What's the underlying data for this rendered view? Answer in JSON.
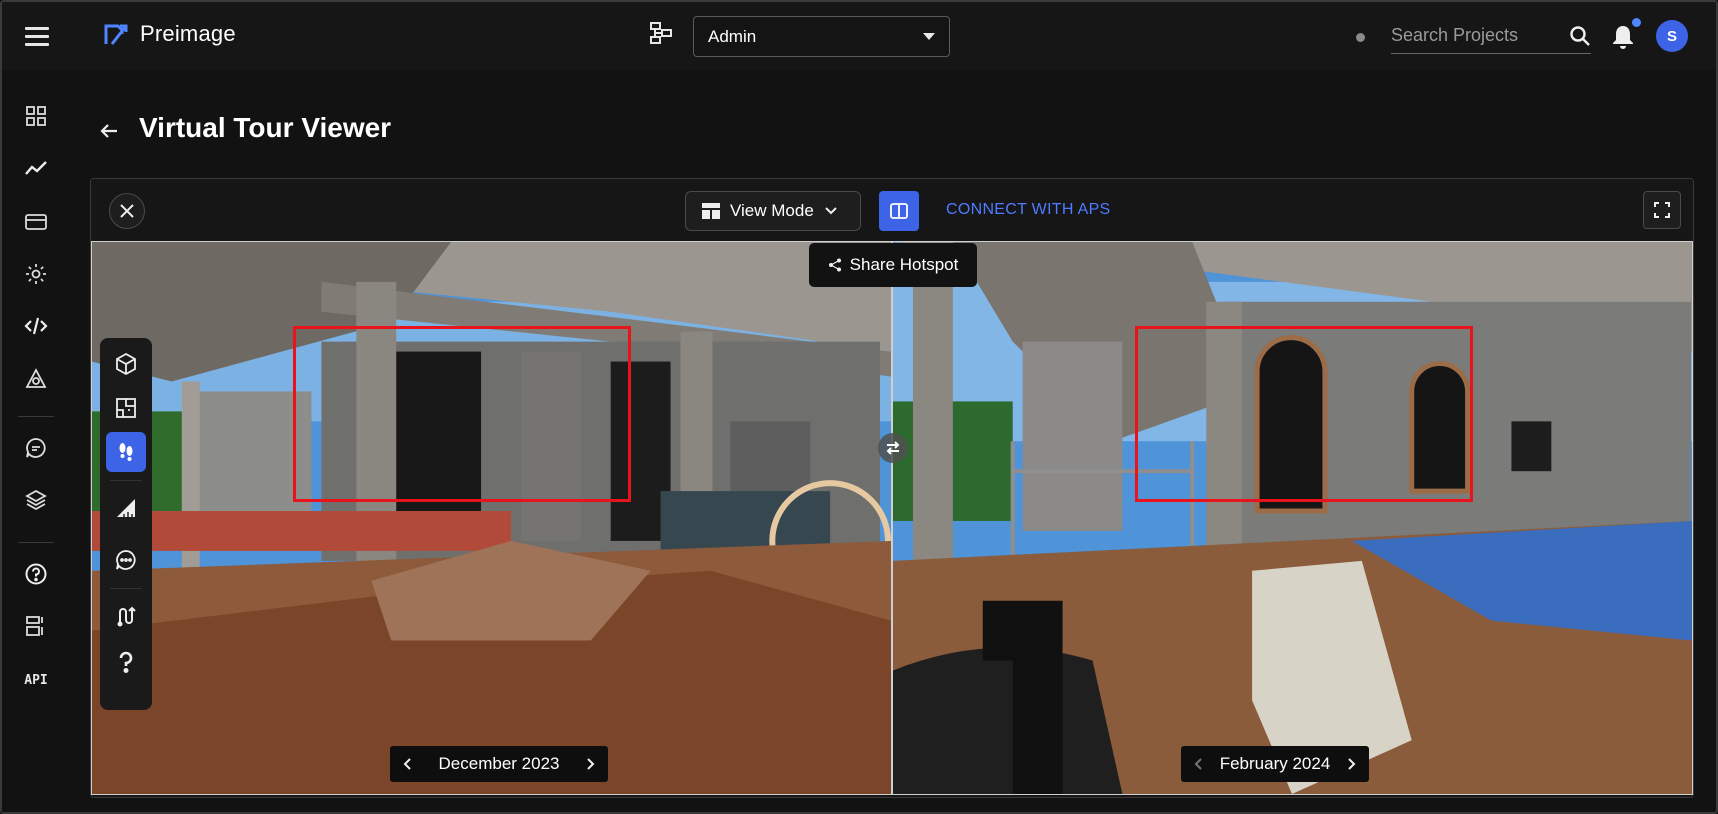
{
  "app": {
    "name": "Preimage",
    "org_select": "Admin",
    "search_placeholder": "Search Projects",
    "avatar_initial": "S"
  },
  "nav": {
    "items": [
      "dashboard-icon",
      "analytics-icon",
      "billing-icon",
      "settings-icon",
      "code-icon",
      "integrations-icon",
      "chat-icon",
      "layers-icon",
      "help-icon",
      "forms-icon"
    ],
    "api_label": "API"
  },
  "page": {
    "title": "Virtual Tour Viewer"
  },
  "viewer": {
    "view_mode_label": "View Mode",
    "connect_label": "CONNECT WITH APS",
    "share_hotspot_label": "Share Hotspot",
    "left_date": "December 2023",
    "right_date": "February 2024",
    "tools": [
      "cube-icon",
      "floorplan-icon",
      "footsteps-icon",
      "measure-icon",
      "comment-icon",
      "path-icon",
      "question-icon"
    ]
  },
  "colors": {
    "accent": "#3d63e6",
    "link": "#4f7bff",
    "highlight_box": "#e8131b"
  }
}
